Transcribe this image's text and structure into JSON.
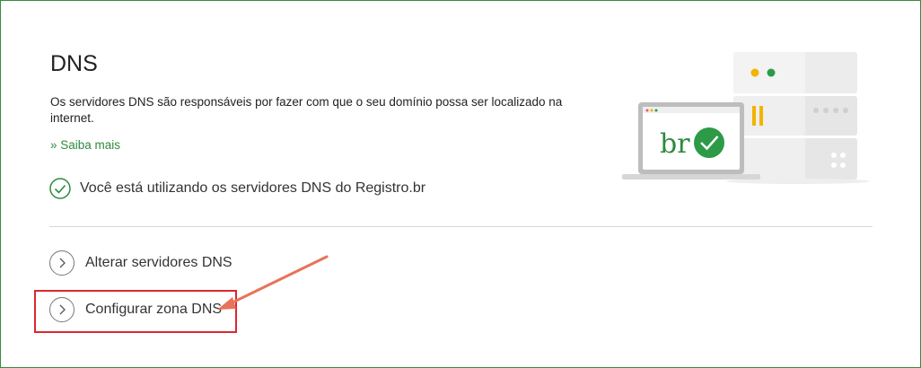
{
  "section": {
    "title": "DNS",
    "description": "Os servidores DNS são responsáveis por fazer com que o seu domínio possa ser localizado na internet.",
    "learn_more": "» Saiba mais",
    "status_text": "Você está utilizando os servidores DNS do Registro.br"
  },
  "actions": [
    {
      "label": "Alterar servidores DNS"
    },
    {
      "label": "Configurar zona DNS"
    }
  ],
  "illustration": {
    "brand_text": "br"
  },
  "colors": {
    "accent_green": "#2d8a3e",
    "annotation_red": "#d9282f",
    "annotation_arrow": "#e8735a"
  }
}
